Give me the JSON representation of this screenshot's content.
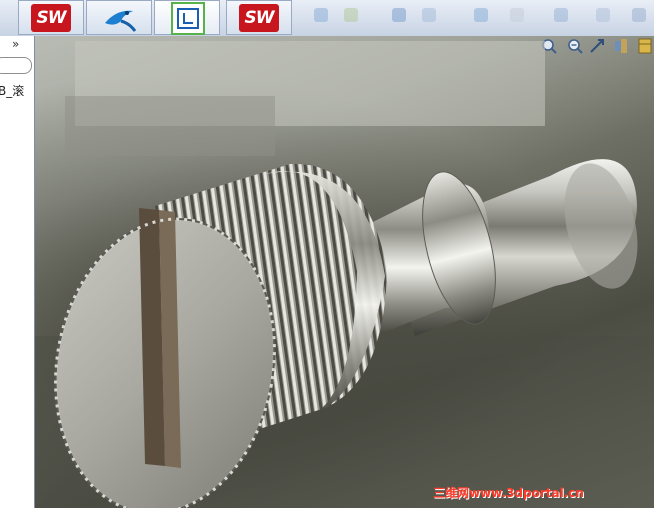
{
  "taskbar": {
    "buttons": [
      {
        "name": "solidworks-1",
        "label": "SW"
      },
      {
        "name": "kingfisher-app",
        "label": ""
      },
      {
        "name": "sketch-app",
        "label": ""
      },
      {
        "name": "solidworks-2",
        "label": "SW"
      }
    ]
  },
  "left_panel": {
    "collapse_glyph": "»",
    "filter_value": "",
    "tree_item": "B_滚"
  },
  "viewport": {
    "model_name": "knurled-slotted-thumb-screw"
  },
  "watermark": "三维网www.3dportal.cn",
  "colors": {
    "solidworks_red": "#c8161e",
    "watermark_red": "#ff3b2a"
  }
}
